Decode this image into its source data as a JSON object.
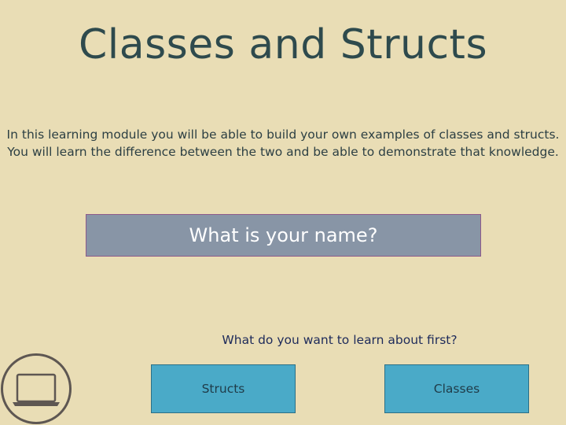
{
  "header": {
    "title": "Classes and Structs"
  },
  "intro": {
    "line1": "In this learning module you will be able to build your own examples of classes and structs.",
    "line2": "You will learn the difference between the two and be able to demonstrate that knowledge."
  },
  "name_input": {
    "placeholder": "What is your name?",
    "value": ""
  },
  "choice": {
    "question": "What do you want to learn about first?",
    "structs_label": "Structs",
    "classes_label": "Classes"
  },
  "icons": {
    "badge": "laptop-icon"
  },
  "colors": {
    "background": "#e9ddb5",
    "title": "#2e4a4d",
    "name_field": "#8895a6",
    "button": "#4aaac8",
    "question_text": "#1d2a5a"
  }
}
